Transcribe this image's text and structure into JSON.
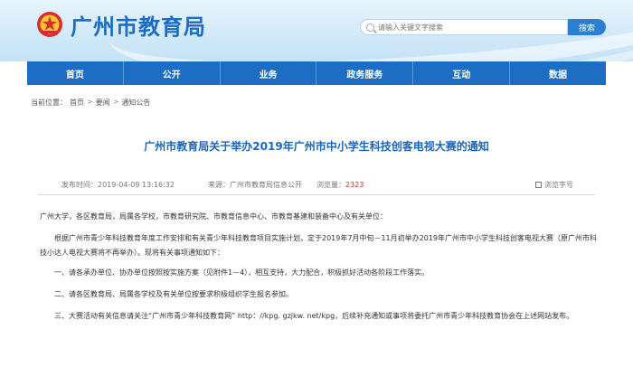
{
  "site": {
    "title": "广州市教育局",
    "colors": {
      "primary": "#1c6ec4",
      "accent_red": "#c0392b",
      "title_blue": "#1a66bf"
    },
    "logo_icon": "emblem-icon"
  },
  "search": {
    "placeholder": "请输入关键文字搜索",
    "button_label": "搜索"
  },
  "nav": {
    "items": [
      {
        "label": "首页"
      },
      {
        "label": "公开"
      },
      {
        "label": "业务"
      },
      {
        "label": "政务服务"
      },
      {
        "label": "互动"
      },
      {
        "label": "数据"
      }
    ]
  },
  "breadcrumb": {
    "prefix": "当前位置：",
    "items": [
      "首页",
      "要闻",
      "通知公告"
    ],
    "separator": ">"
  },
  "article": {
    "title": "广州市教育局关于举办2019年广州市中小学生科技创客电视大赛的通知",
    "meta": {
      "publish_time": "发布时间：2019-04-09 13:16:32",
      "source": "来源：广州市教育局信息公开",
      "views_label": "浏览量：",
      "views_count": "2323",
      "font_size_label": "浏览字号"
    },
    "paragraphs": [
      "广州大学，各区教育局，局属各学校，市教育研究院、市教育信息中心、市教育基建和装备中心及有关单位：",
      "根据广州市青少年科技教育年度工作安排和有关青少年科技教育项目实施计划，定于2019年7月中旬－11月初举办2019年广州市中小学生科技创客电视大赛（原广州市科技小达人电视大赛将不再举办）。现将有关事项通知如下：",
      "一、请各承办单位、协办单位按照按实施方案（见附件1－4），相互支持，大力配合，积极抓好活动各阶段工作落实。",
      "二、请各区教育局、局属各学校及有关单位按要求积极组织学生报名参加。",
      "三、大赛活动有关信息请关注“广州市青少年科技教育网” http：//kpg. gzjkw. net/kpg，后续补充通知或事项将委托广州市青少年科技教育协会在上述网站发布。"
    ]
  }
}
